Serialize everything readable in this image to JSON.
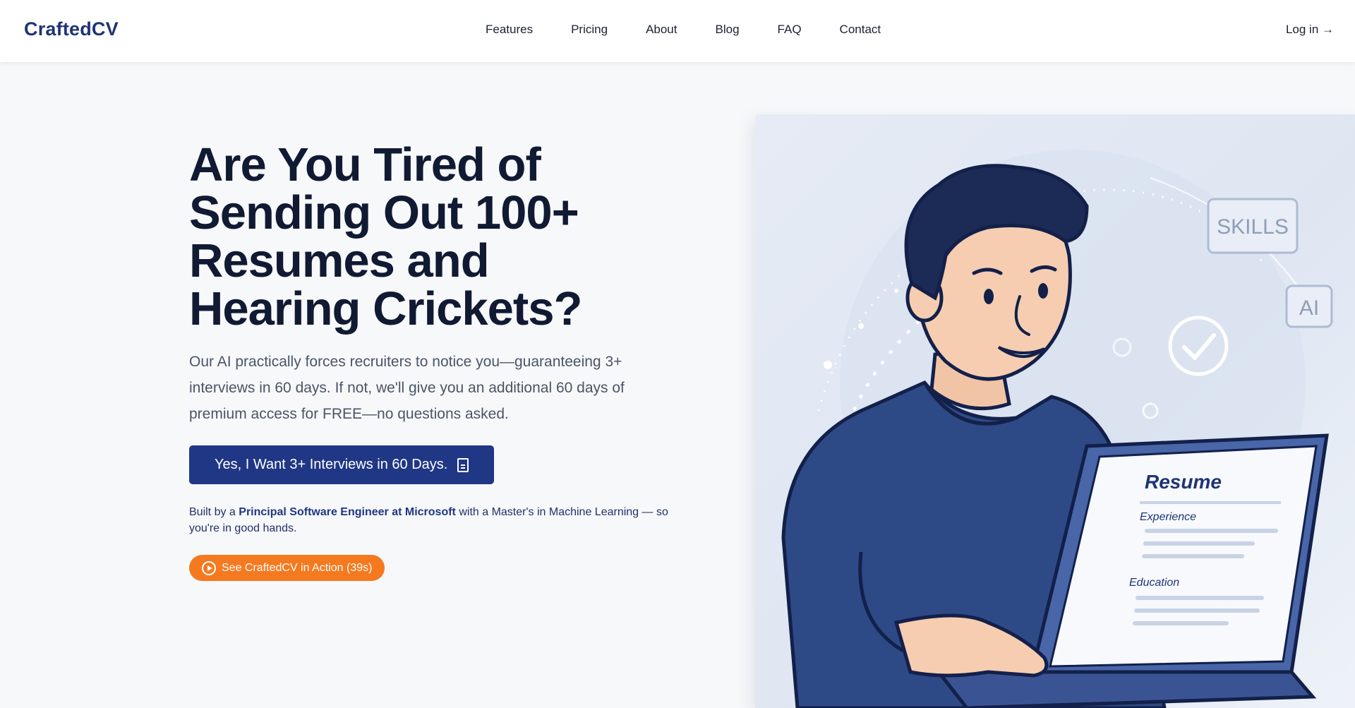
{
  "header": {
    "logo": "CraftedCV",
    "nav": [
      "Features",
      "Pricing",
      "About",
      "Blog",
      "FAQ",
      "Contact"
    ],
    "login": "Log in →"
  },
  "hero": {
    "headline_lines": [
      "Are You Tired of",
      "Sending Out 100+",
      "Resumes and",
      "Hearing Crickets?"
    ],
    "subtext": "Our AI practically forces recruiters to notice you—guaranteeing 3+ interviews in 60 days. If not, we'll give you an additional 60 days of premium access for FREE—no questions asked.",
    "cta_label": "Yes, I Want 3+ Interviews in 60 Days.",
    "built_prefix": "Built by a ",
    "built_bold": "Principal Software Engineer at Microsoft",
    "built_suffix": " with a Master's in Machine Learning — so you're in good hands.",
    "demo_label": "See CraftedCV in Action (39s)"
  },
  "illustration": {
    "tags": [
      "SKILLS",
      "AI"
    ],
    "resume_title": "Resume",
    "resume_sections": [
      "Experience",
      "Education"
    ]
  },
  "colors": {
    "brand": "#1f3477",
    "cta": "#1f3785",
    "accent": "#f5791f"
  }
}
